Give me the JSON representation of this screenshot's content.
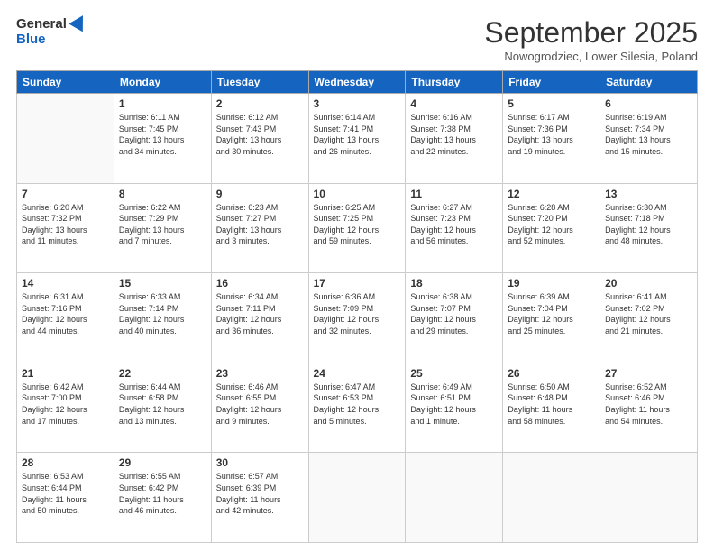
{
  "header": {
    "logo_general": "General",
    "logo_blue": "Blue",
    "month_title": "September 2025",
    "subtitle": "Nowogrodziec, Lower Silesia, Poland"
  },
  "weekdays": [
    "Sunday",
    "Monday",
    "Tuesday",
    "Wednesday",
    "Thursday",
    "Friday",
    "Saturday"
  ],
  "weeks": [
    [
      {
        "day": "",
        "info": ""
      },
      {
        "day": "1",
        "info": "Sunrise: 6:11 AM\nSunset: 7:45 PM\nDaylight: 13 hours\nand 34 minutes."
      },
      {
        "day": "2",
        "info": "Sunrise: 6:12 AM\nSunset: 7:43 PM\nDaylight: 13 hours\nand 30 minutes."
      },
      {
        "day": "3",
        "info": "Sunrise: 6:14 AM\nSunset: 7:41 PM\nDaylight: 13 hours\nand 26 minutes."
      },
      {
        "day": "4",
        "info": "Sunrise: 6:16 AM\nSunset: 7:38 PM\nDaylight: 13 hours\nand 22 minutes."
      },
      {
        "day": "5",
        "info": "Sunrise: 6:17 AM\nSunset: 7:36 PM\nDaylight: 13 hours\nand 19 minutes."
      },
      {
        "day": "6",
        "info": "Sunrise: 6:19 AM\nSunset: 7:34 PM\nDaylight: 13 hours\nand 15 minutes."
      }
    ],
    [
      {
        "day": "7",
        "info": "Sunrise: 6:20 AM\nSunset: 7:32 PM\nDaylight: 13 hours\nand 11 minutes."
      },
      {
        "day": "8",
        "info": "Sunrise: 6:22 AM\nSunset: 7:29 PM\nDaylight: 13 hours\nand 7 minutes."
      },
      {
        "day": "9",
        "info": "Sunrise: 6:23 AM\nSunset: 7:27 PM\nDaylight: 13 hours\nand 3 minutes."
      },
      {
        "day": "10",
        "info": "Sunrise: 6:25 AM\nSunset: 7:25 PM\nDaylight: 12 hours\nand 59 minutes."
      },
      {
        "day": "11",
        "info": "Sunrise: 6:27 AM\nSunset: 7:23 PM\nDaylight: 12 hours\nand 56 minutes."
      },
      {
        "day": "12",
        "info": "Sunrise: 6:28 AM\nSunset: 7:20 PM\nDaylight: 12 hours\nand 52 minutes."
      },
      {
        "day": "13",
        "info": "Sunrise: 6:30 AM\nSunset: 7:18 PM\nDaylight: 12 hours\nand 48 minutes."
      }
    ],
    [
      {
        "day": "14",
        "info": "Sunrise: 6:31 AM\nSunset: 7:16 PM\nDaylight: 12 hours\nand 44 minutes."
      },
      {
        "day": "15",
        "info": "Sunrise: 6:33 AM\nSunset: 7:14 PM\nDaylight: 12 hours\nand 40 minutes."
      },
      {
        "day": "16",
        "info": "Sunrise: 6:34 AM\nSunset: 7:11 PM\nDaylight: 12 hours\nand 36 minutes."
      },
      {
        "day": "17",
        "info": "Sunrise: 6:36 AM\nSunset: 7:09 PM\nDaylight: 12 hours\nand 32 minutes."
      },
      {
        "day": "18",
        "info": "Sunrise: 6:38 AM\nSunset: 7:07 PM\nDaylight: 12 hours\nand 29 minutes."
      },
      {
        "day": "19",
        "info": "Sunrise: 6:39 AM\nSunset: 7:04 PM\nDaylight: 12 hours\nand 25 minutes."
      },
      {
        "day": "20",
        "info": "Sunrise: 6:41 AM\nSunset: 7:02 PM\nDaylight: 12 hours\nand 21 minutes."
      }
    ],
    [
      {
        "day": "21",
        "info": "Sunrise: 6:42 AM\nSunset: 7:00 PM\nDaylight: 12 hours\nand 17 minutes."
      },
      {
        "day": "22",
        "info": "Sunrise: 6:44 AM\nSunset: 6:58 PM\nDaylight: 12 hours\nand 13 minutes."
      },
      {
        "day": "23",
        "info": "Sunrise: 6:46 AM\nSunset: 6:55 PM\nDaylight: 12 hours\nand 9 minutes."
      },
      {
        "day": "24",
        "info": "Sunrise: 6:47 AM\nSunset: 6:53 PM\nDaylight: 12 hours\nand 5 minutes."
      },
      {
        "day": "25",
        "info": "Sunrise: 6:49 AM\nSunset: 6:51 PM\nDaylight: 12 hours\nand 1 minute."
      },
      {
        "day": "26",
        "info": "Sunrise: 6:50 AM\nSunset: 6:48 PM\nDaylight: 11 hours\nand 58 minutes."
      },
      {
        "day": "27",
        "info": "Sunrise: 6:52 AM\nSunset: 6:46 PM\nDaylight: 11 hours\nand 54 minutes."
      }
    ],
    [
      {
        "day": "28",
        "info": "Sunrise: 6:53 AM\nSunset: 6:44 PM\nDaylight: 11 hours\nand 50 minutes."
      },
      {
        "day": "29",
        "info": "Sunrise: 6:55 AM\nSunset: 6:42 PM\nDaylight: 11 hours\nand 46 minutes."
      },
      {
        "day": "30",
        "info": "Sunrise: 6:57 AM\nSunset: 6:39 PM\nDaylight: 11 hours\nand 42 minutes."
      },
      {
        "day": "",
        "info": ""
      },
      {
        "day": "",
        "info": ""
      },
      {
        "day": "",
        "info": ""
      },
      {
        "day": "",
        "info": ""
      }
    ]
  ]
}
